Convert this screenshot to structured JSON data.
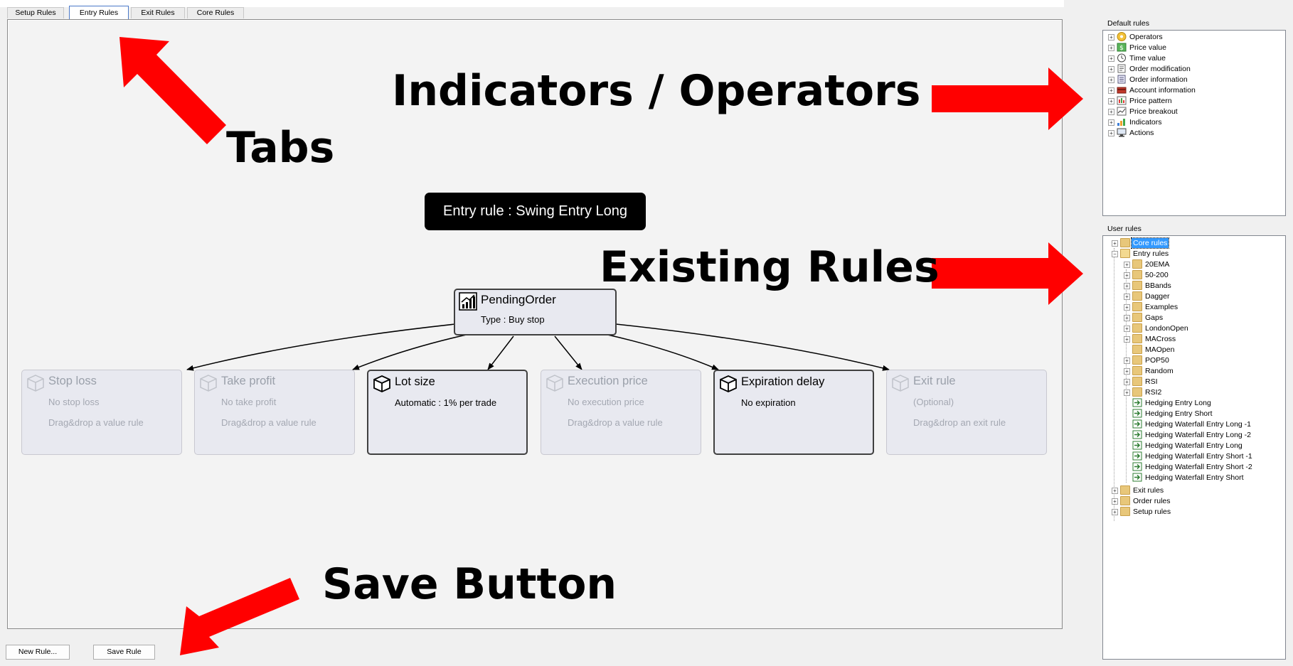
{
  "tabs": [
    {
      "label": "Setup Rules",
      "active": false
    },
    {
      "label": "Entry Rules",
      "active": true
    },
    {
      "label": "Exit Rules",
      "active": false
    },
    {
      "label": "Core Rules",
      "active": false
    }
  ],
  "canvas": {
    "entry_rule_label": "Entry rule : Swing Entry Long",
    "pending_order": {
      "title": "PendingOrder",
      "subtitle": "Type : Buy stop",
      "icon": "chart-icon"
    },
    "nodes": [
      {
        "title": "Stop loss",
        "line1": "No stop loss",
        "line2": "Drag&drop a value rule",
        "active": false
      },
      {
        "title": "Take profit",
        "line1": "No take profit",
        "line2": "Drag&drop a value rule",
        "active": false
      },
      {
        "title": "Lot size",
        "line1": "Automatic : 1% per trade",
        "line2": "",
        "active": true
      },
      {
        "title": "Execution price",
        "line1": "No execution price",
        "line2": "Drag&drop a value rule",
        "active": false
      },
      {
        "title": "Expiration delay",
        "line1": "No expiration",
        "line2": "",
        "active": true
      },
      {
        "title": "Exit rule",
        "line1": "(Optional)",
        "line2": "Drag&drop an exit rule",
        "active": false
      }
    ]
  },
  "buttons": {
    "new_rule": "New Rule...",
    "save_rule": "Save Rule"
  },
  "default_rules": {
    "group_label": "Default rules",
    "items": [
      {
        "label": "Operators",
        "icon": "operators-icon"
      },
      {
        "label": "Price value",
        "icon": "price-value-icon"
      },
      {
        "label": "Time value",
        "icon": "clock-icon"
      },
      {
        "label": "Order modification",
        "icon": "order-modification-icon"
      },
      {
        "label": "Order information",
        "icon": "order-information-icon"
      },
      {
        "label": "Account information",
        "icon": "account-icon"
      },
      {
        "label": "Price pattern",
        "icon": "price-pattern-icon"
      },
      {
        "label": "Price breakout",
        "icon": "price-breakout-icon"
      },
      {
        "label": "Indicators",
        "icon": "indicators-icon"
      },
      {
        "label": "Actions",
        "icon": "actions-icon"
      }
    ]
  },
  "user_rules": {
    "group_label": "User rules",
    "top": {
      "label": "Core rules",
      "selected": true
    },
    "entry": {
      "label": "Entry rules",
      "folders": [
        "20EMA",
        "50-200",
        "BBands",
        "Dagger",
        "Examples",
        "Gaps",
        "LondonOpen",
        "MACross",
        "MAOpen",
        "POP50",
        "Random",
        "RSI",
        "RSI2"
      ],
      "rules": [
        "Hedging Entry Long",
        "Hedging Entry Short",
        "Hedging Waterfall Entry Long -1",
        "Hedging Waterfall Entry Long -2",
        "Hedging Waterfall Entry Long",
        "Hedging Waterfall Entry Short -1",
        "Hedging Waterfall Entry Short -2",
        "Hedging Waterfall Entry Short"
      ]
    },
    "bottom": [
      "Exit rules",
      "Order rules",
      "Setup rules"
    ]
  },
  "annotations": {
    "tabs": "Tabs",
    "indicators": "Indicators / Operators",
    "existing": "Existing Rules",
    "save": "Save Button"
  },
  "colors": {
    "arrow": "#ff0000",
    "selection": "#3399ff",
    "node_bg": "#e8e9f0"
  }
}
